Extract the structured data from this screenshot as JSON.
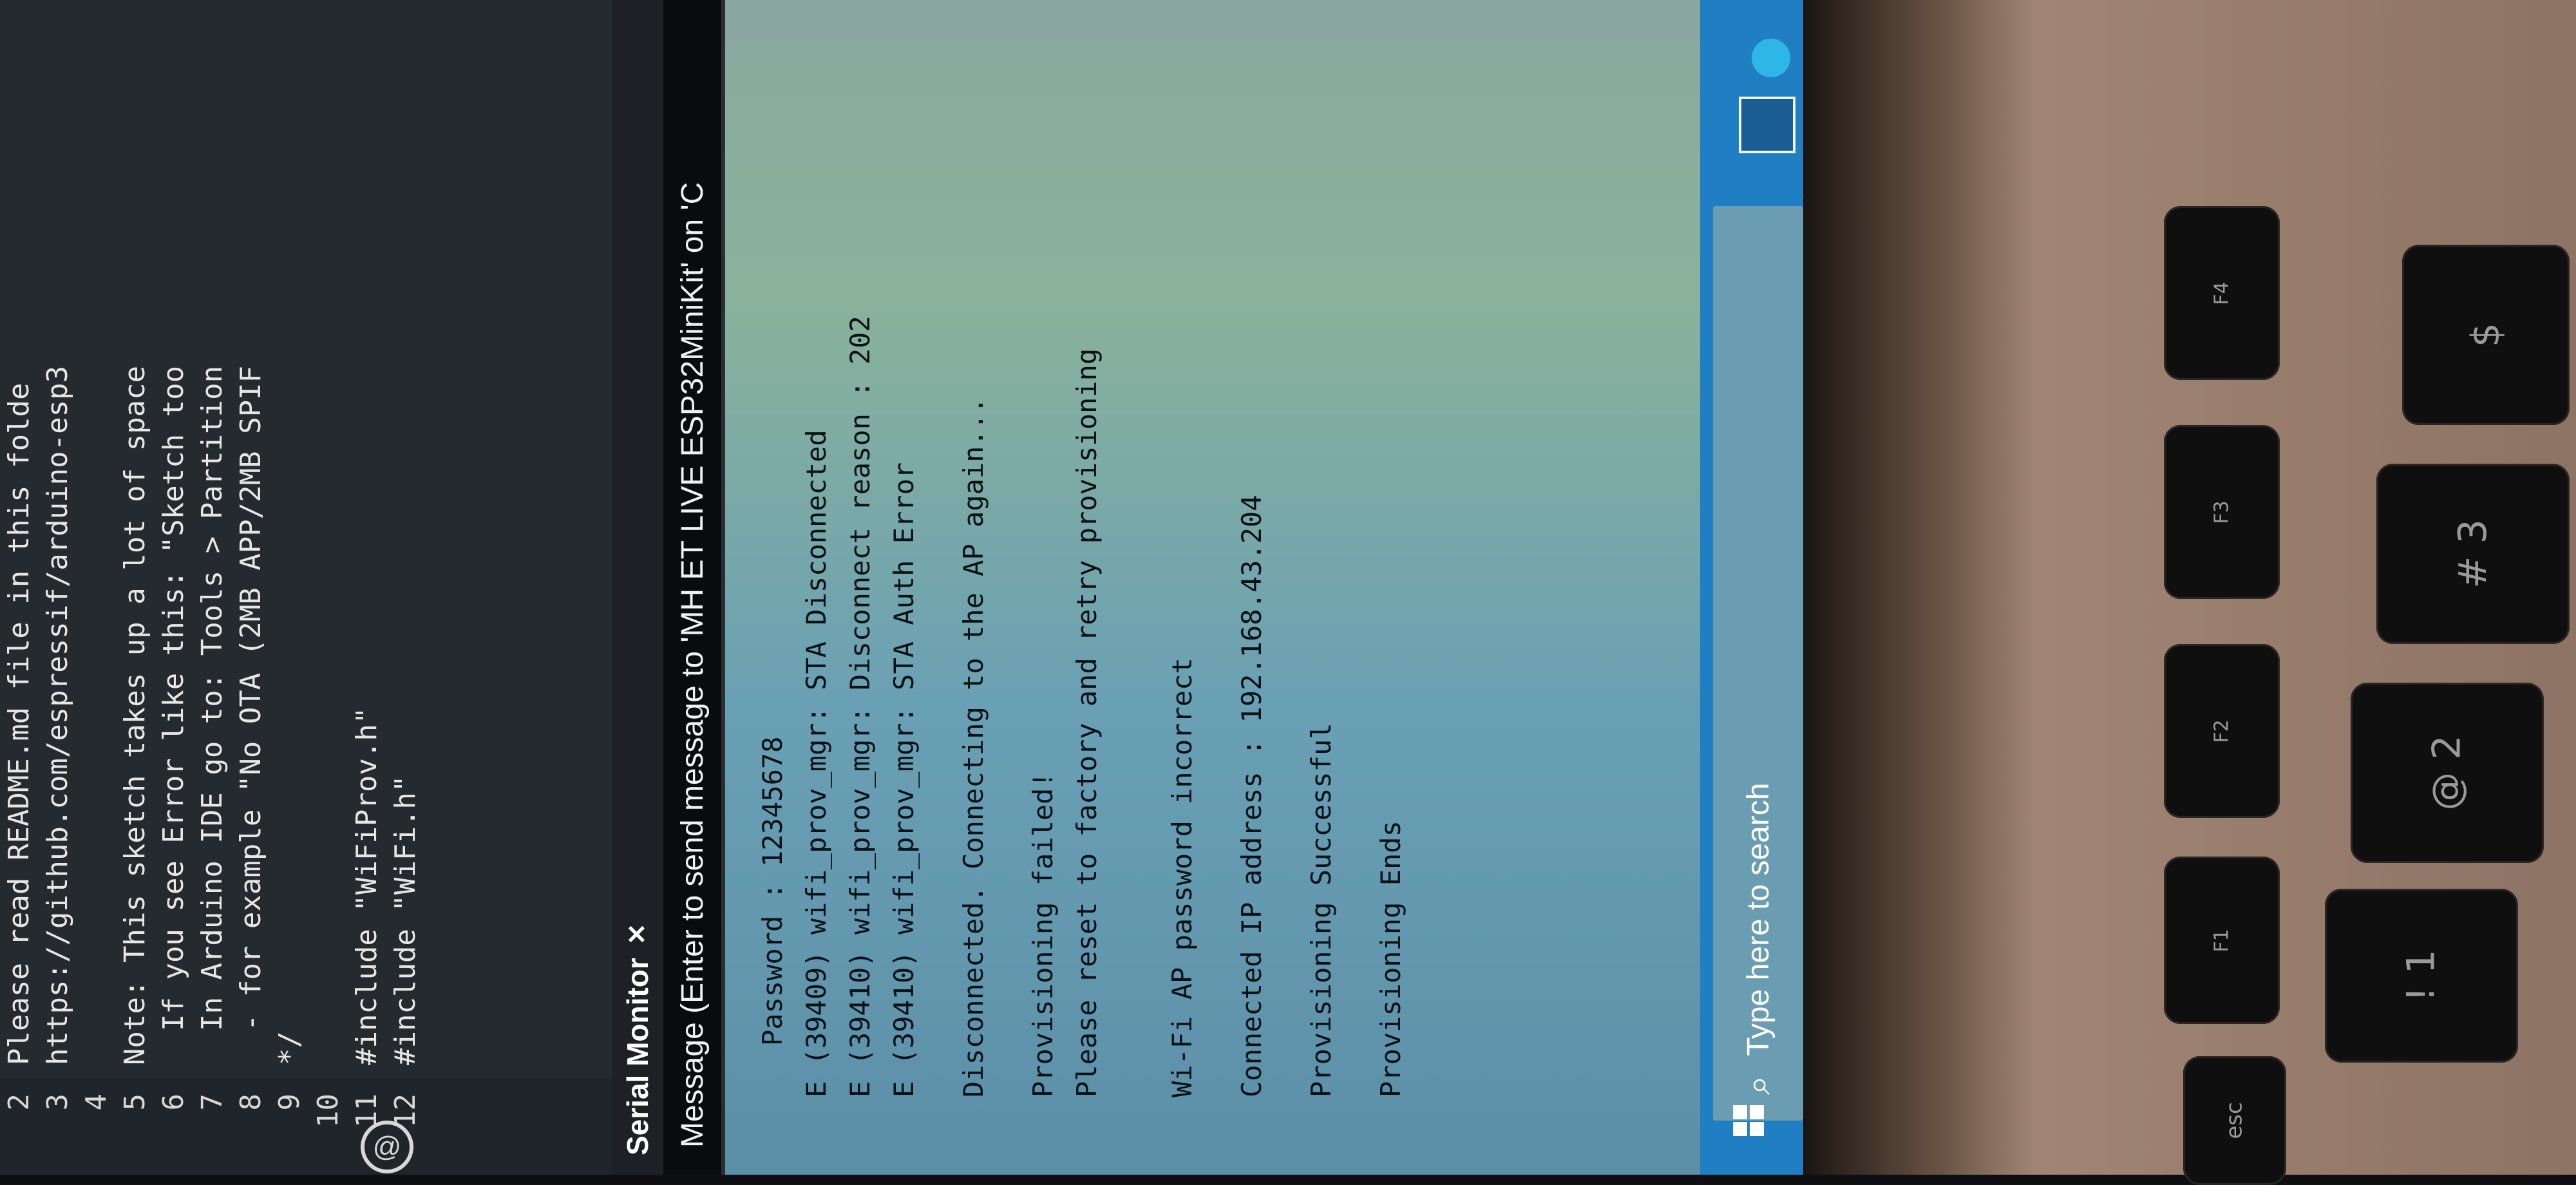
{
  "editor": {
    "line_numbers": [
      "2",
      "3",
      "4",
      "5",
      "6",
      "7",
      "8",
      "9",
      "10",
      "11",
      "12"
    ],
    "lines": [
      "Please read README.md file in this folde",
      "https://github.com/espressif/arduino-esp3",
      "",
      "Note: This sketch takes up a lot of space",
      "  If you see Error like this: \"Sketch too",
      "  In Arduino IDE go to: Tools > Partition",
      "  - for example \"No OTA (2MB APP/2MB SPIF",
      "*/",
      "",
      "#include \"WiFiProv.h\"",
      "#include \"WiFi.h\""
    ]
  },
  "serial_monitor": {
    "tab_label": "Serial Monitor",
    "close_glyph": "✕",
    "input_placeholder": "Message (Enter to send message to 'MH ET LIVE ESP32MiniKit' on 'C",
    "output": [
      "Password : 12345678",
      "E (39409) wifi_prov_mgr: STA Disconnected",
      "E (39410) wifi_prov_mgr: Disconnect reason : 202",
      "E (39410) wifi_prov_mgr: STA Auth Error",
      "",
      "Disconnected. Connecting to the AP again...",
      "",
      "Provisioning failed!",
      "Please reset to factory and retry provisioning",
      "",
      "",
      "Wi-Fi AP password incorrect",
      "",
      "Connected IP address : 192.168.43.204",
      "",
      "Provisioning Successful",
      "",
      "Provisioning Ends"
    ]
  },
  "taskbar": {
    "search_placeholder": "Type here to search",
    "search_icon": "search-icon",
    "start_icon": "windows-start-icon"
  },
  "keyboard": {
    "keys": [
      "esc",
      "F1",
      "F2",
      "F3",
      "F4",
      "!",
      "1",
      "@",
      "2",
      "#",
      "3",
      "$"
    ]
  },
  "colors": {
    "taskbar": "#1f7fc2",
    "output_bg": "#6aa0b4",
    "editor_bg": "#252a2f",
    "keyword": "#d05f9c"
  }
}
